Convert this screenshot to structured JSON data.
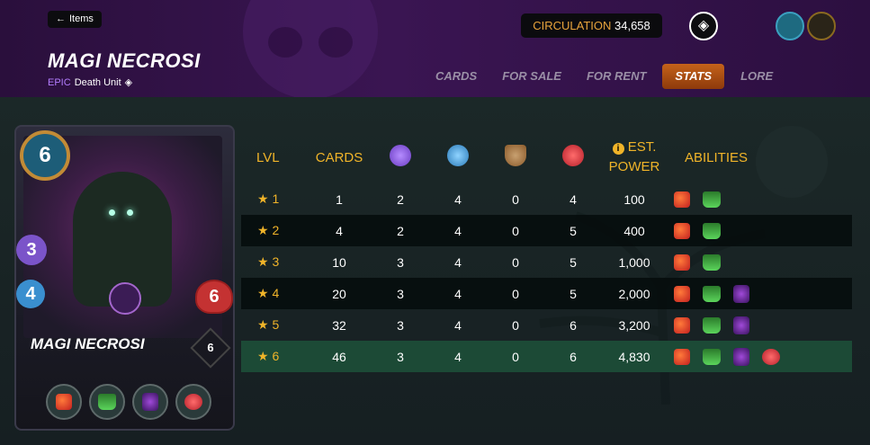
{
  "header": {
    "back_label": "Items",
    "card_name": "MAGI NECROSI",
    "rarity": "EPIC",
    "type_text": "Death Unit",
    "circulation_label": "CIRCULATION",
    "circulation_value": "34,658"
  },
  "tabs": [
    {
      "label": "CARDS",
      "active": false
    },
    {
      "label": "FOR SALE",
      "active": false
    },
    {
      "label": "FOR RENT",
      "active": false
    },
    {
      "label": "STATS",
      "active": true
    },
    {
      "label": "LORE",
      "active": false
    }
  ],
  "card": {
    "mana": "6",
    "magic": "3",
    "speed": "4",
    "health": "6",
    "name": "MAGI NECROSI",
    "level": "6",
    "abilities": [
      "ability-red-icon",
      "ability-green-icon",
      "ability-purple-icon",
      "ability-pig-icon"
    ]
  },
  "stats_table": {
    "headers": {
      "lvl": "LVL",
      "cards": "CARDS",
      "magic_icon": "magic-icon",
      "speed_icon": "speed-icon",
      "armor_icon": "armor-icon",
      "health_icon": "health-icon",
      "est_power": "EST. POWER",
      "abilities": "ABILITIES"
    },
    "rows": [
      {
        "lvl": "★ 1",
        "cards": "1",
        "magic": "2",
        "speed": "4",
        "armor": "0",
        "health": "4",
        "power": "100",
        "abilities": 2
      },
      {
        "lvl": "★ 2",
        "cards": "4",
        "magic": "2",
        "speed": "4",
        "armor": "0",
        "health": "5",
        "power": "400",
        "abilities": 2
      },
      {
        "lvl": "★ 3",
        "cards": "10",
        "magic": "3",
        "speed": "4",
        "armor": "0",
        "health": "5",
        "power": "1,000",
        "abilities": 2
      },
      {
        "lvl": "★ 4",
        "cards": "20",
        "magic": "3",
        "speed": "4",
        "armor": "0",
        "health": "5",
        "power": "2,000",
        "abilities": 3
      },
      {
        "lvl": "★ 5",
        "cards": "32",
        "magic": "3",
        "speed": "4",
        "armor": "0",
        "health": "6",
        "power": "3,200",
        "abilities": 3
      },
      {
        "lvl": "★ 6",
        "cards": "46",
        "magic": "3",
        "speed": "4",
        "armor": "0",
        "health": "6",
        "power": "4,830",
        "abilities": 4
      }
    ]
  },
  "colors": {
    "accent": "#f0b429",
    "active_tab": "#c4621a",
    "rarity": "#b37dff",
    "current_row": "#1c4a36"
  }
}
